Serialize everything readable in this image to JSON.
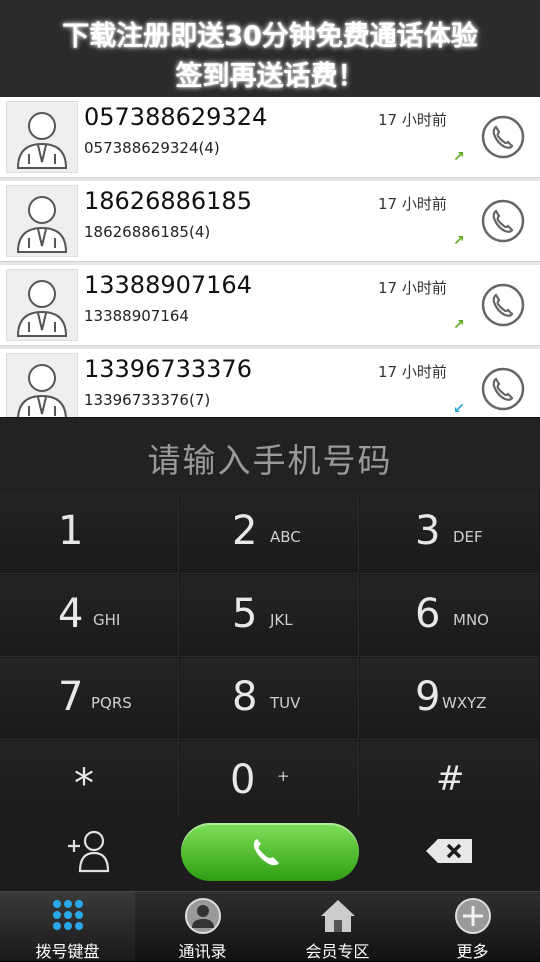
{
  "banner": {
    "line1": "下载注册即送30分钟免费通话体验",
    "line2": "签到再送话费！"
  },
  "calls": [
    {
      "number": "057388629324",
      "detail": "057388629324(4)",
      "time": "17 小时前",
      "direction": "outgoing"
    },
    {
      "number": "18626886185",
      "detail": "18626886185(4)",
      "time": "17 小时前",
      "direction": "outgoing"
    },
    {
      "number": "13388907164",
      "detail": "13388907164",
      "time": "17 小时前",
      "direction": "outgoing"
    },
    {
      "number": "13396733376",
      "detail": "13396733376(7)",
      "time": "17 小时前",
      "direction": "incoming"
    }
  ],
  "input": {
    "placeholder": "请输入手机号码"
  },
  "keypad": [
    {
      "digit": "1",
      "letters": ""
    },
    {
      "digit": "2",
      "letters": "ABC"
    },
    {
      "digit": "3",
      "letters": "DEF"
    },
    {
      "digit": "4",
      "letters": "GHI"
    },
    {
      "digit": "5",
      "letters": "JKL"
    },
    {
      "digit": "6",
      "letters": "MNO"
    },
    {
      "digit": "7",
      "letters": "PQRS"
    },
    {
      "digit": "8",
      "letters": "TUV"
    },
    {
      "digit": "9",
      "letters": "WXYZ"
    },
    {
      "digit": "*",
      "letters": ""
    },
    {
      "digit": "0",
      "letters": "+"
    },
    {
      "digit": "#",
      "letters": ""
    }
  ],
  "nav": [
    {
      "label": "拨号键盘",
      "icon": "dialpad-icon",
      "active": true
    },
    {
      "label": "通讯录",
      "icon": "contacts-icon",
      "active": false
    },
    {
      "label": "会员专区",
      "icon": "home-icon",
      "active": false
    },
    {
      "label": "更多",
      "icon": "plus-icon",
      "active": false
    }
  ],
  "colors": {
    "call_green": "#3aaa1c",
    "outgoing_arrow": "#5aaa1a",
    "incoming_arrow": "#2aa0e0"
  }
}
